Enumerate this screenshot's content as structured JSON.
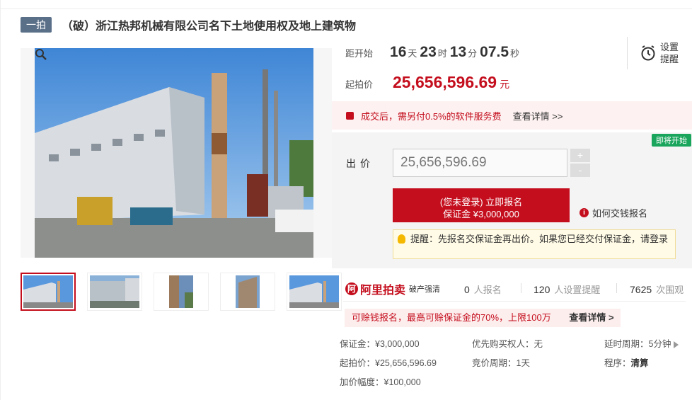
{
  "header": {
    "tag": "一拍",
    "title": "（破）浙江热邦机械有限公司名下土地使用权及地上建筑物"
  },
  "countdown": {
    "label": "距开始",
    "days": "16",
    "days_unit": "天",
    "hours": "23",
    "hours_unit": "时",
    "minutes": "13",
    "minutes_unit": "分",
    "seconds": "07.5",
    "seconds_unit": "秒"
  },
  "reminder": {
    "icon": "alarm-clock-icon",
    "label_line1": "设置",
    "label_line2": "提醒"
  },
  "starting_price": {
    "label": "起拍价",
    "value": "25,656,596.69",
    "unit": "元"
  },
  "fee_notice": {
    "text": "成交后，需另付0.5%的软件服务费",
    "link": "查看详情 >>"
  },
  "bid": {
    "badge": "即将开始",
    "label": "出价",
    "input_value": "25,656,596.69",
    "plus": "+",
    "minus": "-",
    "signup_line1": "(您未登录) 立即报名",
    "signup_line2": "保证金 ¥3,000,000",
    "how_icon": "i",
    "how_link": "如何交钱报名",
    "tip": "提醒：先报名交保证金再出价。如果您已经交付保证金，请登录"
  },
  "platform": {
    "logo": "阿",
    "name": "阿里拍卖",
    "sub": "破产强清"
  },
  "stats": [
    {
      "value": "0",
      "label": "人报名"
    },
    {
      "value": "120",
      "label": "人设置提醒"
    },
    {
      "value": "7625",
      "label": "次围观"
    }
  ],
  "promo": {
    "text": "可赊钱报名，最高可赊保证金的70%，上限100万",
    "link": "查看详情 >"
  },
  "details": {
    "deposit": {
      "label": "保证金：",
      "value": "¥3,000,000"
    },
    "priority": {
      "label": "优先购买权人",
      "value": "：无"
    },
    "delay": {
      "label": "延时周期：",
      "value": "5分钟"
    },
    "start_price": {
      "label": "起拍价：",
      "value": "¥25,656,596.69"
    },
    "bid_cycle": {
      "label": "竞价周期：",
      "value": "1天"
    },
    "procedure": {
      "label": "程序：",
      "value": "清算"
    },
    "increment": {
      "label": "加价幅度：",
      "value": "¥100,000"
    }
  }
}
